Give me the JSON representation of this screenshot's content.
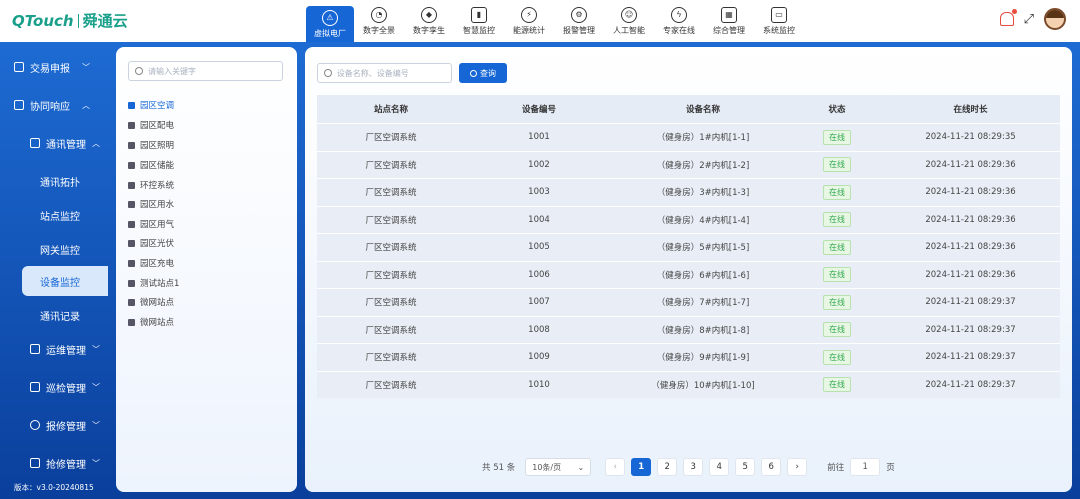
{
  "brand": {
    "en": "QTouch",
    "cn": "舜通云"
  },
  "modules": [
    {
      "label": "虚拟电厂",
      "icon": "warning-triangle-icon",
      "glyph": "⚠",
      "active": true
    },
    {
      "label": "数字全景",
      "icon": "chart-circle-icon",
      "glyph": "◔"
    },
    {
      "label": "数字孪生",
      "icon": "cube-icon",
      "glyph": "◆"
    },
    {
      "label": "智慧监控",
      "icon": "bar-chart-icon",
      "glyph": "▮"
    },
    {
      "label": "能源统计",
      "icon": "energy-icon",
      "glyph": "⚡"
    },
    {
      "label": "报警管理",
      "icon": "alarm-gear-icon",
      "glyph": "⚙"
    },
    {
      "label": "人工智能",
      "icon": "ai-head-icon",
      "glyph": "☺"
    },
    {
      "label": "专家在线",
      "icon": "expert-bolt-icon",
      "glyph": "ϟ"
    },
    {
      "label": "综合管理",
      "icon": "grid-apps-icon",
      "glyph": "▦"
    },
    {
      "label": "系统监控",
      "icon": "monitor-icon",
      "glyph": "▭"
    }
  ],
  "sidebar": {
    "items": [
      {
        "label": "交易申报",
        "expand": "﹀"
      },
      {
        "label": "协同响应",
        "expand": "︿"
      },
      {
        "label": "通讯管理",
        "expand": "︿"
      },
      {
        "label": "通讯拓扑"
      },
      {
        "label": "站点监控"
      },
      {
        "label": "网关监控"
      },
      {
        "label": "设备监控"
      },
      {
        "label": "通讯记录"
      },
      {
        "label": "运维管理",
        "expand": "﹀"
      },
      {
        "label": "巡检管理",
        "expand": "﹀"
      },
      {
        "label": "报修管理",
        "expand": "﹀"
      },
      {
        "label": "抢修管理",
        "expand": "﹀"
      }
    ],
    "version": "版本：v3.0-20240815"
  },
  "tree": {
    "search_placeholder": "请输入关键字",
    "items": [
      "园区空调",
      "园区配电",
      "园区照明",
      "园区储能",
      "环控系统",
      "园区用水",
      "园区用气",
      "园区光伏",
      "园区充电",
      "测试站点1",
      "微网站点",
      "微网站点"
    ]
  },
  "filter": {
    "placeholder": "设备名称、设备编号",
    "query_label": "查询"
  },
  "table": {
    "headers": [
      "站点名称",
      "设备编号",
      "设备名称",
      "状态",
      "在线时长"
    ],
    "rows": [
      [
        "厂区空调系统",
        "1001",
        "（健身房）1#内机[1-1]",
        "在线",
        "2024-11-21 08:29:35"
      ],
      [
        "厂区空调系统",
        "1002",
        "（健身房）2#内机[1-2]",
        "在线",
        "2024-11-21 08:29:36"
      ],
      [
        "厂区空调系统",
        "1003",
        "（健身房）3#内机[1-3]",
        "在线",
        "2024-11-21 08:29:36"
      ],
      [
        "厂区空调系统",
        "1004",
        "（健身房）4#内机[1-4]",
        "在线",
        "2024-11-21 08:29:36"
      ],
      [
        "厂区空调系统",
        "1005",
        "（健身房）5#内机[1-5]",
        "在线",
        "2024-11-21 08:29:36"
      ],
      [
        "厂区空调系统",
        "1006",
        "（健身房）6#内机[1-6]",
        "在线",
        "2024-11-21 08:29:36"
      ],
      [
        "厂区空调系统",
        "1007",
        "（健身房）7#内机[1-7]",
        "在线",
        "2024-11-21 08:29:37"
      ],
      [
        "厂区空调系统",
        "1008",
        "（健身房）8#内机[1-8]",
        "在线",
        "2024-11-21 08:29:37"
      ],
      [
        "厂区空调系统",
        "1009",
        "（健身房）9#内机[1-9]",
        "在线",
        "2024-11-21 08:29:37"
      ],
      [
        "厂区空调系统",
        "1010",
        "（健身房）10#内机[1-10]",
        "在线",
        "2024-11-21 08:29:37"
      ]
    ]
  },
  "pagination": {
    "total": "共 51 条",
    "page_size": "10条/页",
    "prev": "‹",
    "next": "›",
    "pages": [
      "1",
      "2",
      "3",
      "4",
      "5",
      "6"
    ],
    "current": "1",
    "goto_label": "前往",
    "goto_value": "1",
    "page_unit": "页"
  },
  "colors": {
    "accent": "#1666d6",
    "online": "#2fa84f",
    "brand": "#1aa08a"
  }
}
